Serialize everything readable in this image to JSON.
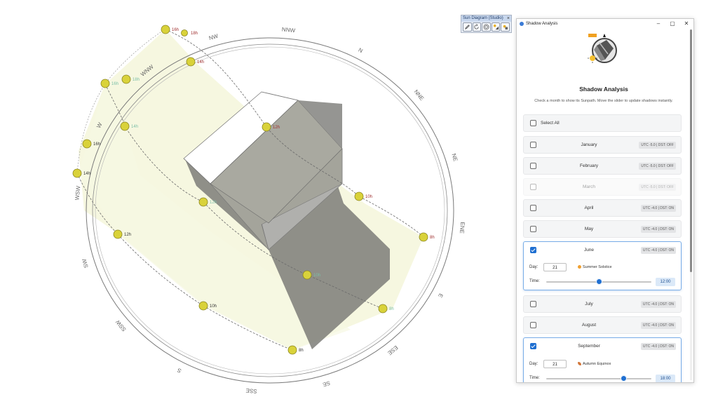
{
  "toolbar": {
    "title": "Sun Diagram (Studio)",
    "close": "×",
    "buttons": [
      "pencil-icon",
      "rotate-icon",
      "target-icon",
      "sun-shadow-icon",
      "sun-icon"
    ]
  },
  "scene": {
    "compass": [
      "N",
      "NNE",
      "NE",
      "ENE",
      "E",
      "ESE",
      "SE",
      "SSE",
      "S",
      "SSW",
      "SW",
      "WSW",
      "W",
      "WNW",
      "NW",
      "NNW"
    ],
    "hour_markers": [
      {
        "label": "16h",
        "color": "#a03030"
      },
      {
        "label": "18h",
        "color": "#a03030"
      },
      {
        "label": "14h",
        "color": "#a03030"
      },
      {
        "label": "16h",
        "color": "#7bbfa8"
      },
      {
        "label": "18h",
        "color": "#7bbfa8"
      },
      {
        "label": "12h",
        "color": "#a03030"
      },
      {
        "label": "14h",
        "color": "#7bbfa8"
      },
      {
        "label": "16h",
        "color": "#333333"
      },
      {
        "label": "14h",
        "color": "#333333"
      },
      {
        "label": "10h",
        "color": "#a03030"
      },
      {
        "label": "12h",
        "color": "#7bbfa8"
      },
      {
        "label": "12h",
        "color": "#333333"
      },
      {
        "label": "8h",
        "color": "#a03030"
      },
      {
        "label": "10h",
        "color": "#7bbfa8"
      },
      {
        "label": "10h",
        "color": "#333333"
      },
      {
        "label": "8h",
        "color": "#7bbfa8"
      },
      {
        "label": "8h",
        "color": "#333333"
      }
    ]
  },
  "window": {
    "title": "Shadow Analysis",
    "controls": [
      "–",
      "▢",
      "✕"
    ]
  },
  "panel": {
    "heading": "Shadow Analysis",
    "instructions": "Check a month to show its Sunpath. Move the slider to update shadows instantly.",
    "select_all": "Select All",
    "day_label": "Day:",
    "time_label": "Time:",
    "months": [
      {
        "name": "January",
        "tz": "UTC -5.0 | DST: OFF",
        "checked": false,
        "dim": false
      },
      {
        "name": "February",
        "tz": "UTC -5.0 | DST: OFF",
        "checked": false,
        "dim": false
      },
      {
        "name": "March",
        "tz": "UTC -5.0 | DST: OFF",
        "checked": false,
        "dim": true
      },
      {
        "name": "April",
        "tz": "UTC -4.0 | DST: ON",
        "checked": false,
        "dim": false
      },
      {
        "name": "May",
        "tz": "UTC -4.0 | DST: ON",
        "checked": false,
        "dim": false
      },
      {
        "name": "June",
        "tz": "UTC -4.0 | DST: ON",
        "checked": true,
        "dim": false,
        "day": "21",
        "event": "Summer Solstice",
        "time": "12:00",
        "time_fraction": 0.5
      },
      {
        "name": "July",
        "tz": "UTC -4.0 | DST: ON",
        "checked": false,
        "dim": false
      },
      {
        "name": "August",
        "tz": "UTC -4.0 | DST: ON",
        "checked": false,
        "dim": false
      },
      {
        "name": "September",
        "tz": "UTC -4.0 | DST: ON",
        "checked": true,
        "dim": false,
        "day": "21",
        "event": "Autumn Equinox",
        "time": "18:00",
        "time_fraction": 0.73
      }
    ]
  },
  "colors": {
    "accent": "#1f6fd1",
    "sun_marker": "#d9d23a"
  }
}
